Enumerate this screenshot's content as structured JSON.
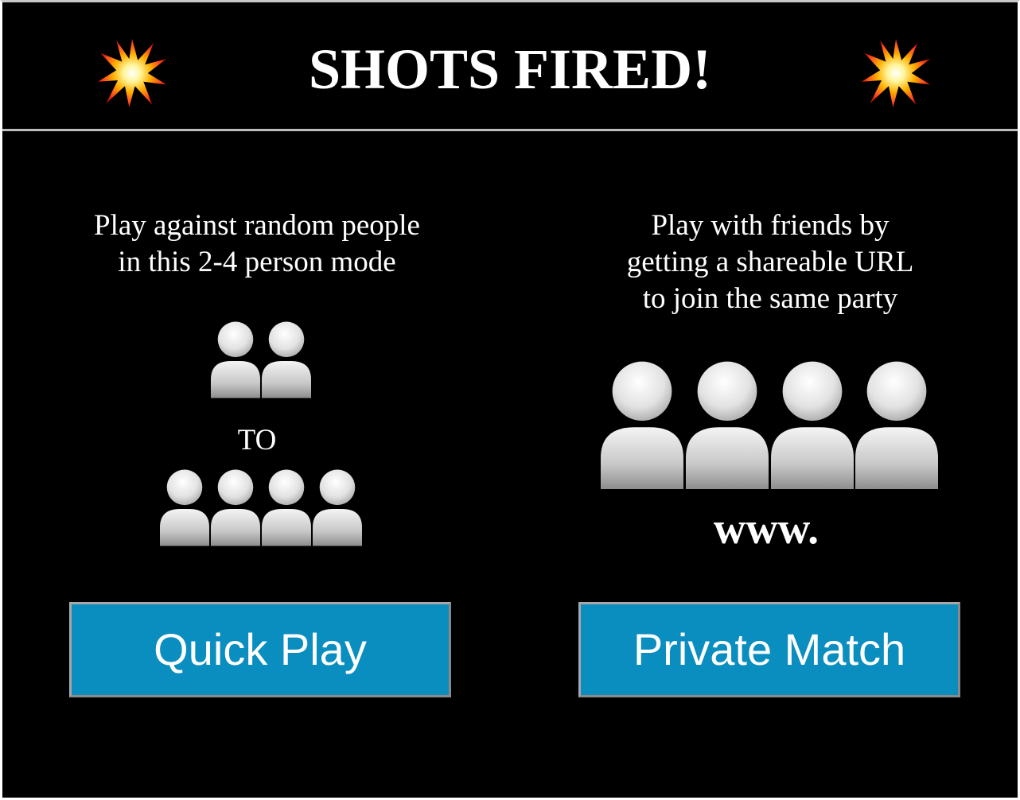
{
  "header": {
    "title": "SHOTS FIRED!",
    "left_icon": "collision-burst-icon",
    "right_icon": "collision-burst-icon"
  },
  "quick_play": {
    "description_lines": [
      "Play against random people",
      "in this 2-4 person mode"
    ],
    "from_icon": "two-people-icon",
    "to_label": "TO",
    "to_icon": "four-people-icon",
    "button_label": "Quick Play"
  },
  "private_match": {
    "description_lines": [
      "Play with friends by",
      "getting a shareable URL",
      "to join the same party"
    ],
    "icon": "four-people-icon",
    "url_label": "www.",
    "button_label": "Private Match"
  },
  "colors": {
    "background": "#000000",
    "button": "#0a8dbf",
    "text": "#ffffff"
  }
}
